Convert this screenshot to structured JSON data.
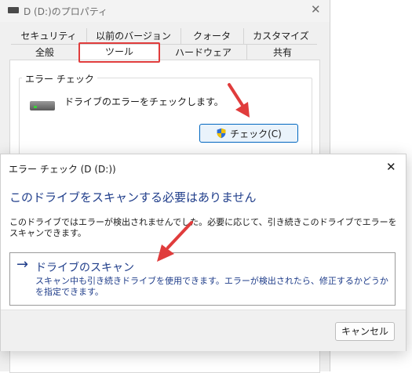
{
  "props_window": {
    "title": "D (D:)のプロパティ",
    "tabs_top": [
      "セキュリティ",
      "以前のバージョン",
      "クォータ",
      "カスタマイズ"
    ],
    "tabs_bottom": [
      "全般",
      "ツール",
      "ハードウェア",
      "共有"
    ],
    "active_tab": "ツール",
    "error_check_group": {
      "label": "エラー チェック",
      "description": "ドライブのエラーをチェックします。",
      "button_label": "チェック(C)"
    }
  },
  "dialog": {
    "title": "エラー チェック (D (D:))",
    "heading": "このドライブをスキャンする必要はありません",
    "message": "このドライブではエラーが検出されませんでした。必要に応じて、引き続きこのドライブでエラーをスキャンできます。",
    "option": {
      "arrow": "→",
      "title": "ドライブのスキャン",
      "description": "スキャン中も引き続きドライブを使用できます。エラーが検出されたら、修正するかどうかを指定できます。"
    },
    "cancel_label": "キャンセル"
  },
  "colors": {
    "highlight": "#e03c3c",
    "link_blue": "#1f3d8a",
    "accent": "#0067c0"
  },
  "icons": [
    "drive-icon",
    "drive-icon",
    "shield-icon",
    "close-icon",
    "arrow-right-icon"
  ]
}
